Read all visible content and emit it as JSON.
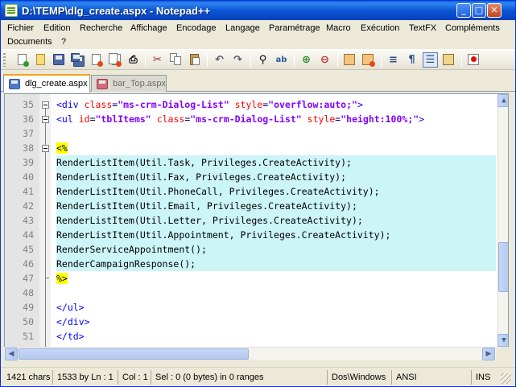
{
  "window": {
    "title": "D:\\TEMP\\dlg_create.aspx - Notepad++",
    "minimize_label": "_",
    "maximize_label": "□",
    "close_label": "✕"
  },
  "menu": [
    "Fichier",
    "Edition",
    "Recherche",
    "Affichage",
    "Encodage",
    "Langage",
    "Paramétrage",
    "Macro",
    "Exécution",
    "TextFX",
    "Compléments",
    "Documents",
    "?"
  ],
  "toolbar": {
    "icons": [
      "new-file-icon",
      "open-file-icon",
      "save-icon",
      "save-all-icon",
      "close-icon",
      "close-all-icon",
      "print-icon",
      "cut-icon",
      "copy-icon",
      "paste-icon",
      "undo-icon",
      "redo-icon",
      "find-icon",
      "replace-icon",
      "zoom-in-icon",
      "zoom-out-icon",
      "sync-vertical-icon",
      "sync-horizontal-icon",
      "word-wrap-icon",
      "show-all-chars-icon",
      "indent-guide-icon",
      "user-language-icon",
      "record-macro-icon"
    ]
  },
  "tabs": [
    {
      "label": "dlg_create.aspx",
      "active": true
    },
    {
      "label": "bar_Top.aspx",
      "active": false
    }
  ],
  "editor": {
    "lines": [
      {
        "num": "35",
        "fold": "open",
        "highlight": false
      },
      {
        "num": "36",
        "fold": "open",
        "highlight": false
      },
      {
        "num": "37",
        "fold": "",
        "highlight": false
      },
      {
        "num": "38",
        "fold": "open",
        "highlight": false
      },
      {
        "num": "39",
        "fold": "",
        "highlight": true
      },
      {
        "num": "40",
        "fold": "",
        "highlight": true
      },
      {
        "num": "41",
        "fold": "",
        "highlight": true
      },
      {
        "num": "42",
        "fold": "",
        "highlight": true
      },
      {
        "num": "43",
        "fold": "",
        "highlight": true
      },
      {
        "num": "44",
        "fold": "",
        "highlight": true
      },
      {
        "num": "45",
        "fold": "",
        "highlight": true
      },
      {
        "num": "46",
        "fold": "",
        "highlight": true
      },
      {
        "num": "47",
        "fold": "end",
        "highlight": false
      },
      {
        "num": "48",
        "fold": "",
        "highlight": false
      },
      {
        "num": "49",
        "fold": "",
        "highlight": false
      },
      {
        "num": "50",
        "fold": "",
        "highlight": false
      },
      {
        "num": "51",
        "fold": "",
        "highlight": false
      }
    ],
    "tokens": {
      "l35": [
        "<div ",
        "class",
        "=",
        "\"ms-crm-Dialog-List\"",
        " ",
        "style",
        "=",
        "\"overflow:auto;\"",
        ">"
      ],
      "l36": [
        "<ul ",
        "id",
        "=",
        "\"tblItems\"",
        " ",
        "class",
        "=",
        "\"ms-crm-Dialog-List\"",
        " ",
        "style",
        "=",
        "\"height:100%;\"",
        ">"
      ],
      "l38": "<%",
      "l39": "RenderListItem(Util.Task, Privileges.CreateActivity);",
      "l40": "RenderListItem(Util.Fax, Privileges.CreateActivity);",
      "l41": "RenderListItem(Util.PhoneCall, Privileges.CreateActivity);",
      "l42": "RenderListItem(Util.Email, Privileges.CreateActivity);",
      "l43": "RenderListItem(Util.Letter, Privileges.CreateActivity);",
      "l44": "RenderListItem(Util.Appointment, Privileges.CreateActivity);",
      "l45": "RenderServiceAppointment();",
      "l46": "RenderCampaignResponse();",
      "l47": "%>",
      "l49": "</ul>",
      "l50": "</div>",
      "l51": "</td>"
    }
  },
  "statusbar": {
    "chars": "1421 chars",
    "bytes_line": "1533 by  Ln : 1",
    "col": "Col : 1",
    "sel": "Sel : 0 (0 bytes) in 0 ranges",
    "eol": "Dos\\Windows",
    "encoding": "ANSI",
    "mode": "INS"
  },
  "colors": {
    "title_bar": "#0b55d4",
    "line_highlight": "#ccf5f8",
    "asp_delimiter_bg": "#ffff00",
    "tag": "#0000ff",
    "attribute": "#ff0000",
    "string": "#8000ff"
  }
}
